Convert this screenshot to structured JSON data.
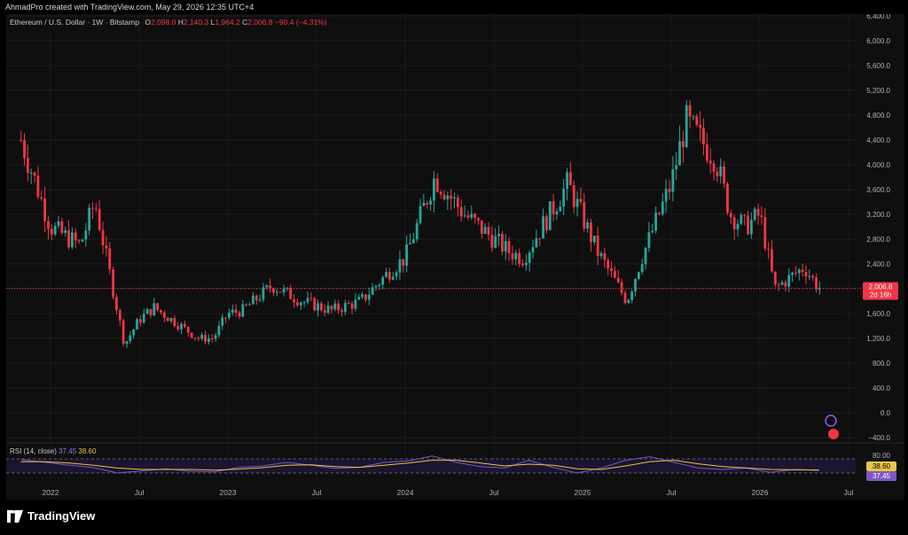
{
  "header": {
    "credit": "AhmadPro created with TradingView.com, May 29, 2026 12:35 UTC+4"
  },
  "legend": {
    "symbol": "Ethereum / U.S. Dollar · 1W · Bitstamp",
    "o_label": "O",
    "o": "2,098.0",
    "h_label": "H",
    "h": "2,140.3",
    "l_label": "L",
    "l": "1,964.2",
    "c_label": "C",
    "c": "2,006.8",
    "chg": "−90.4 (−4.31%)"
  },
  "price_label": {
    "price": "2,006.8",
    "countdown": "2d 16h"
  },
  "rsi": {
    "title": "RSI (14, close)",
    "rsi_value": "37.45",
    "ma_value": "38.60"
  },
  "footer": {
    "brand": "TradingView"
  },
  "colors": {
    "up": "#26a69a",
    "down": "#f23645",
    "rsi": "#7e57c2",
    "rsi_ma": "#e8c547",
    "last_price": "#f23645"
  },
  "chart_data": [
    {
      "type": "candlestick",
      "title": "Ethereum / U.S. Dollar · 1W · Bitstamp",
      "y_ticks": [
        "6,400.0",
        "6,000.0",
        "5,600.0",
        "5,200.0",
        "4,800.0",
        "4,400.0",
        "4,000.0",
        "3,600.0",
        "3,200.0",
        "2,800.0",
        "2,400.0",
        "2,000.0",
        "1,600.0",
        "1,200.0",
        "800.0",
        "400.0",
        "0.0",
        "−400.0"
      ],
      "x_ticks": [
        "2022",
        "Jul",
        "2023",
        "Jul",
        "2024",
        "Jul",
        "2025",
        "Jul",
        "2026",
        "Jul"
      ],
      "ylim": [
        -400,
        6400
      ],
      "last_price": 2006.8,
      "series": [
        {
          "name": "approx close",
          "x": [
            "2021-11",
            "2022-01",
            "2022-03",
            "2022-04",
            "2022-06",
            "2022-07",
            "2022-08",
            "2022-11",
            "2022-12",
            "2023-01",
            "2023-02",
            "2023-04",
            "2023-06",
            "2023-08",
            "2023-10",
            "2023-12",
            "2024-01",
            "2024-03",
            "2024-05",
            "2024-08",
            "2024-09",
            "2024-12",
            "2025-02",
            "2025-04",
            "2025-05",
            "2025-07",
            "2025-08",
            "2025-10",
            "2025-11",
            "2025-12",
            "2026-01",
            "2026-02",
            "2026-04",
            "2026-05"
          ],
          "values": [
            4400,
            3000,
            2700,
            3400,
            1100,
            1500,
            1700,
            1200,
            1200,
            1600,
            1650,
            2050,
            1800,
            1650,
            1800,
            2300,
            2500,
            3800,
            3200,
            2600,
            2500,
            3700,
            2600,
            1800,
            2500,
            3700,
            4700,
            4100,
            3200,
            3000,
            3200,
            2000,
            2350,
            2006.8
          ]
        }
      ]
    },
    {
      "type": "line",
      "title": "RSI (14, close)",
      "y_ticks": [
        "80.00",
        "38.60",
        "37.45"
      ],
      "ylim": [
        10,
        80
      ],
      "series": [
        {
          "name": "RSI",
          "values": [
            68,
            60,
            52,
            45,
            30,
            36,
            42,
            35,
            33,
            46,
            50,
            60,
            52,
            43,
            46,
            60,
            64,
            78,
            60,
            48,
            44,
            66,
            46,
            30,
            44,
            66,
            76,
            60,
            44,
            40,
            44,
            32,
            40,
            37.45
          ]
        },
        {
          "name": "RSI MA",
          "values": [
            62,
            62,
            58,
            52,
            44,
            40,
            40,
            40,
            38,
            41,
            45,
            52,
            53,
            48,
            46,
            52,
            58,
            66,
            66,
            58,
            50,
            55,
            52,
            42,
            40,
            50,
            62,
            66,
            56,
            48,
            44,
            40,
            39,
            38.6
          ]
        }
      ]
    }
  ]
}
